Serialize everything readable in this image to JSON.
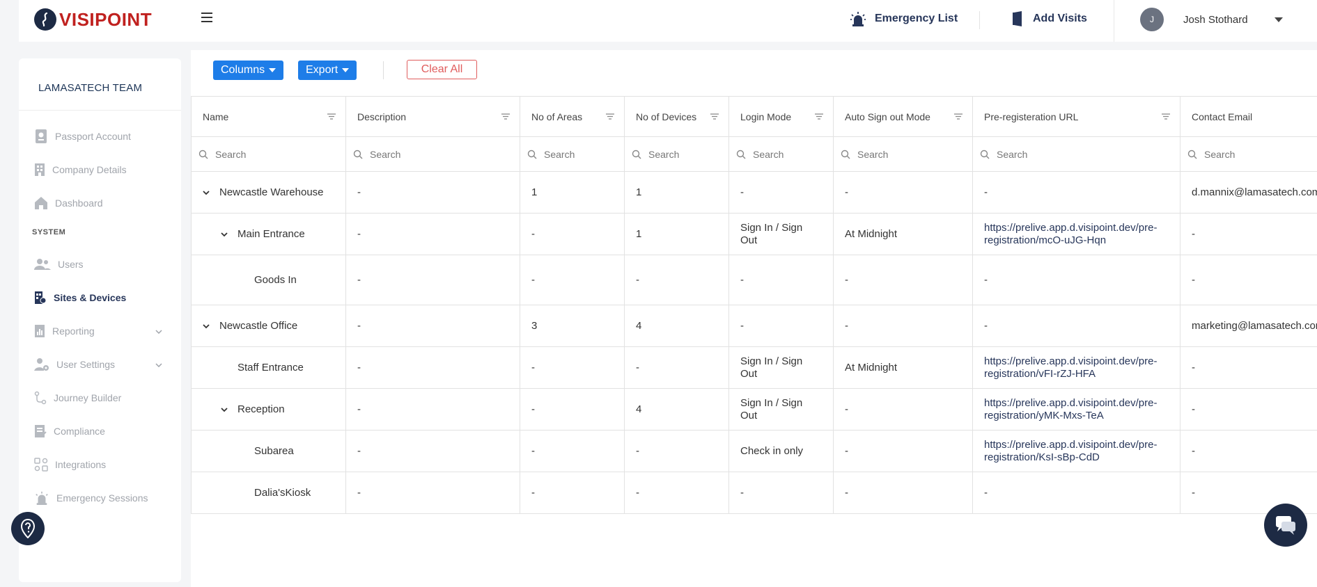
{
  "app": {
    "logo_text": "VISIPOINT"
  },
  "header": {
    "emergency_list": "Emergency List",
    "add_visits": "Add Visits",
    "user_initial": "J",
    "user_name": "Josh Stothard"
  },
  "sidebar": {
    "team": "LAMASATECH TEAM",
    "section_system": "SYSTEM",
    "items": [
      {
        "label": "Passport Account",
        "icon": "passport-icon"
      },
      {
        "label": "Company Details",
        "icon": "building-icon"
      },
      {
        "label": "Dashboard",
        "icon": "home-icon"
      },
      {
        "label": "Users",
        "icon": "users-icon"
      },
      {
        "label": "Sites & Devices",
        "icon": "sites-icon",
        "active": true
      },
      {
        "label": "Reporting",
        "icon": "reporting-icon",
        "expandable": true
      },
      {
        "label": "User Settings",
        "icon": "user-settings-icon",
        "expandable": true
      },
      {
        "label": "Journey Builder",
        "icon": "journey-icon"
      },
      {
        "label": "Compliance",
        "icon": "compliance-icon"
      },
      {
        "label": "Integrations",
        "icon": "integrations-icon"
      },
      {
        "label": "Emergency Sessions",
        "icon": "emergency-icon"
      }
    ]
  },
  "toolbar": {
    "columns_label": "Columns",
    "export_label": "Export",
    "clear_all_label": "Clear All"
  },
  "table": {
    "columns": [
      "Name",
      "Description",
      "No of Areas",
      "No of Devices",
      "Login Mode",
      "Auto Sign out Mode",
      "Pre-registeration URL",
      "Contact Email"
    ],
    "search_placeholder": "Search",
    "rows": [
      {
        "name": "Newcastle Warehouse",
        "level": 0,
        "expandable": true,
        "description": "-",
        "areas": "1",
        "devices": "1",
        "login_mode": "-",
        "auto_signout": "-",
        "url": "-",
        "email": "d.mannix@lamasatech.com"
      },
      {
        "name": "Main Entrance",
        "level": 1,
        "expandable": true,
        "description": "-",
        "areas": "-",
        "devices": "1",
        "login_mode": "Sign In / Sign Out",
        "auto_signout": "At Midnight",
        "url": "https://prelive.app.d.visipoint.dev/pre-registration/mcO-uJG-Hqn",
        "email": "-"
      },
      {
        "name": "Goods In",
        "level": 2,
        "expandable": false,
        "description": "-",
        "areas": "-",
        "devices": "-",
        "login_mode": "-",
        "auto_signout": "-",
        "url": "-",
        "email": "-"
      },
      {
        "name": "Newcastle Office",
        "level": 0,
        "expandable": true,
        "description": "-",
        "areas": "3",
        "devices": "4",
        "login_mode": "-",
        "auto_signout": "-",
        "url": "-",
        "email": "marketing@lamasatech.com"
      },
      {
        "name": "Staff Entrance",
        "level": 1,
        "expandable": false,
        "description": "-",
        "areas": "-",
        "devices": "-",
        "login_mode": "Sign In / Sign Out",
        "auto_signout": "At Midnight",
        "url": "https://prelive.app.d.visipoint.dev/pre-registration/vFI-rZJ-HFA",
        "email": "-"
      },
      {
        "name": "Reception",
        "level": 1,
        "expandable": true,
        "description": "-",
        "areas": "-",
        "devices": "4",
        "login_mode": "Sign In / Sign Out",
        "auto_signout": "-",
        "url": "https://prelive.app.d.visipoint.dev/pre-registration/yMK-Mxs-TeA",
        "email": "-"
      },
      {
        "name": "Subarea",
        "level": 2,
        "expandable": false,
        "description": "-",
        "areas": "-",
        "devices": "-",
        "login_mode": "Check in only",
        "auto_signout": "-",
        "url": "https://prelive.app.d.visipoint.dev/pre-registration/KsI-sBp-CdD",
        "email": "-"
      },
      {
        "name": "Dalia'sKiosk",
        "level": 2,
        "expandable": false,
        "description": "-",
        "areas": "-",
        "devices": "-",
        "login_mode": "-",
        "auto_signout": "-",
        "url": "-",
        "email": "-"
      }
    ]
  },
  "colors": {
    "brand_red": "#c0211f",
    "brand_navy": "#1d2a44",
    "accent_blue": "#1e7de8",
    "clear_red": "#e05c5c"
  }
}
